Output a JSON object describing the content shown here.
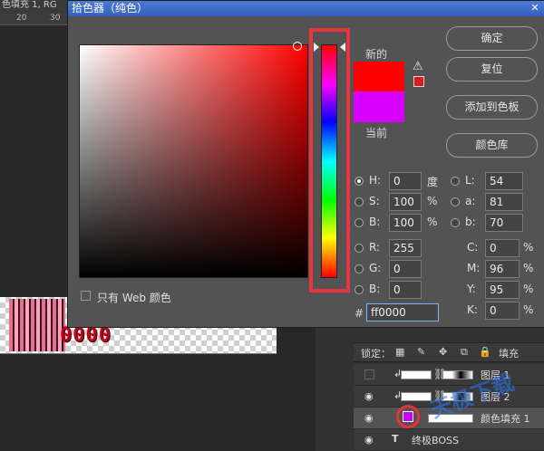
{
  "background": {
    "doc_tab": "色填充 1, RG",
    "ruler_ticks": [
      "20",
      "30"
    ],
    "canvas_text": "0000",
    "lock_label": "锁定：",
    "fill_label": "填充",
    "layers": [
      {
        "name": "图层 1",
        "visible": false
      },
      {
        "name": "图层 2",
        "visible": true
      },
      {
        "name": "颜色填充 1",
        "visible": true,
        "selected": true
      },
      {
        "name": "终极BOSS",
        "visible": true
      }
    ],
    "watermark": "天极下载"
  },
  "dialog": {
    "title": "拾色器（纯色）",
    "close_glyph": "✕",
    "new_label": "新的",
    "current_label": "当前",
    "new_color": "#ff0000",
    "current_color": "#d800ff",
    "warn_glyph": "⚠",
    "buttons": {
      "ok": "确定",
      "reset": "复位",
      "add_swatch": "添加到色板",
      "libraries": "颜色库"
    },
    "fields": {
      "H": {
        "label": "H:",
        "value": "0",
        "unit": "度"
      },
      "S": {
        "label": "S:",
        "value": "100",
        "unit": "%"
      },
      "Bv": {
        "label": "B:",
        "value": "100",
        "unit": "%"
      },
      "R": {
        "label": "R:",
        "value": "255"
      },
      "G": {
        "label": "G:",
        "value": "0"
      },
      "Bl": {
        "label": "B:",
        "value": "0"
      },
      "L": {
        "label": "L:",
        "value": "54"
      },
      "a": {
        "label": "a:",
        "value": "81"
      },
      "b": {
        "label": "b:",
        "value": "70"
      },
      "C": {
        "label": "C:",
        "value": "0",
        "unit": "%"
      },
      "M": {
        "label": "M:",
        "value": "96",
        "unit": "%"
      },
      "Y": {
        "label": "Y:",
        "value": "95",
        "unit": "%"
      },
      "K": {
        "label": "K:",
        "value": "0",
        "unit": "%"
      }
    },
    "web_only_label": "只有 Web 颜色",
    "hash": "#",
    "hex_value": "ff0000",
    "highlight_color": "#e8353f"
  }
}
